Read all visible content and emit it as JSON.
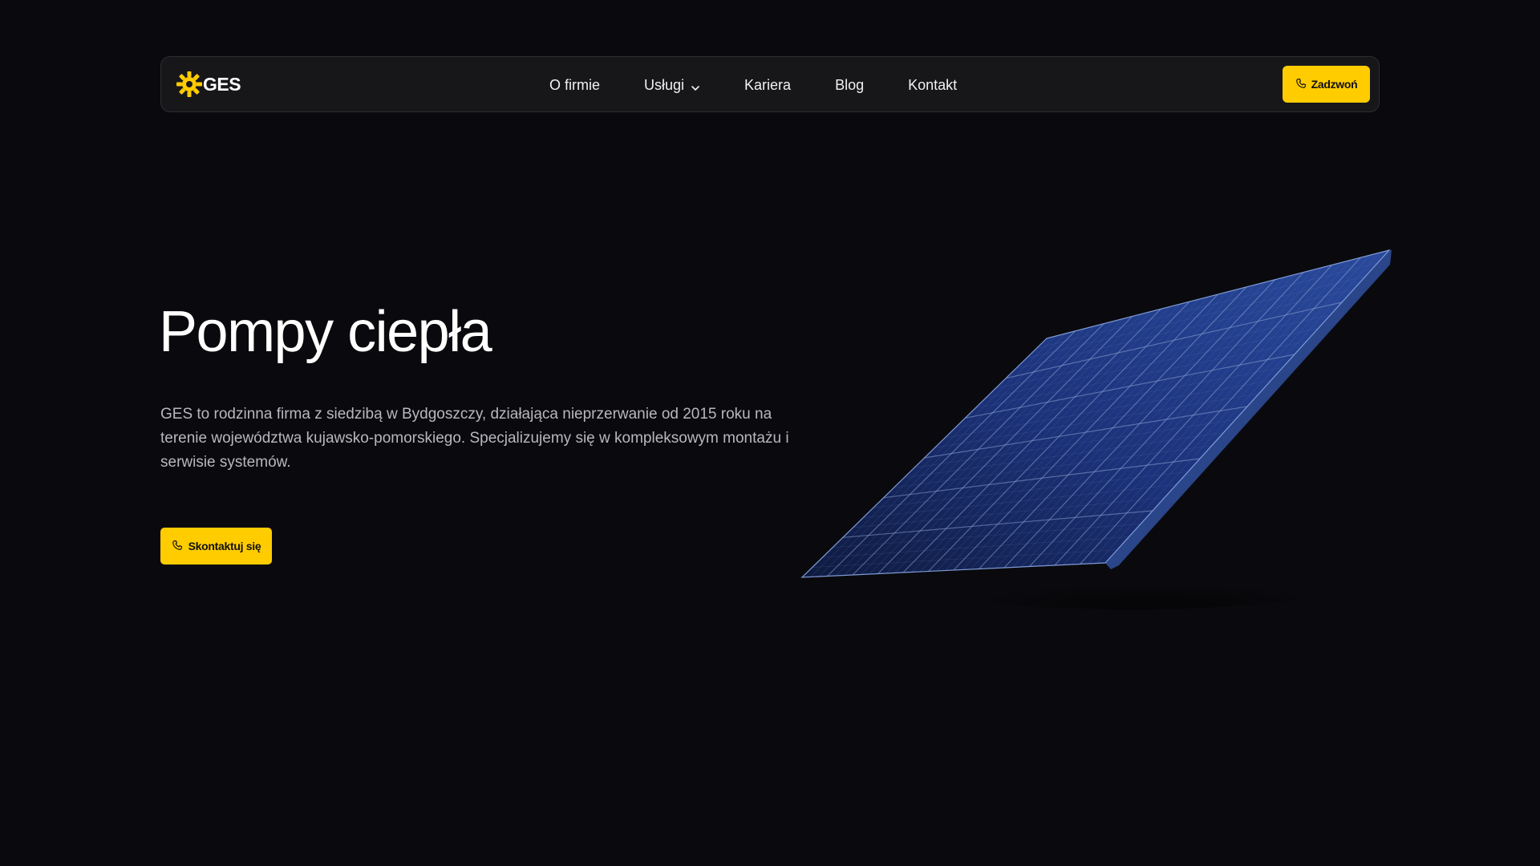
{
  "brand": {
    "name": "GES",
    "logo_icon": "sun-gear-icon",
    "accent_color": "#ffcc00"
  },
  "nav": {
    "items": [
      {
        "label": "O firmie"
      },
      {
        "label": "Usługi",
        "icon": "chevron-down-icon"
      },
      {
        "label": "Kariera"
      },
      {
        "label": "Blog"
      },
      {
        "label": "Kontakt"
      }
    ],
    "call_label": "Zadzwoń",
    "call_icon": "phone-icon"
  },
  "hero": {
    "title": "Pompy ciepła",
    "description": "GES to rodzinna firma z siedzibą w Bydgoszczy, działająca nieprzerwanie od 2015 roku na terenie województwa kujawsko-pomorskiego. Specjalizujemy się w kompleksowym montażu i serwisie systemów.",
    "cta_label": "Skontaktuj się",
    "cta_icon": "phone-icon",
    "image": "solar-panel-image"
  },
  "colors": {
    "background": "#0a0a0e",
    "navbar": "#17171a",
    "accent": "#ffcc00",
    "panel_blue": "#1b2f6b"
  }
}
